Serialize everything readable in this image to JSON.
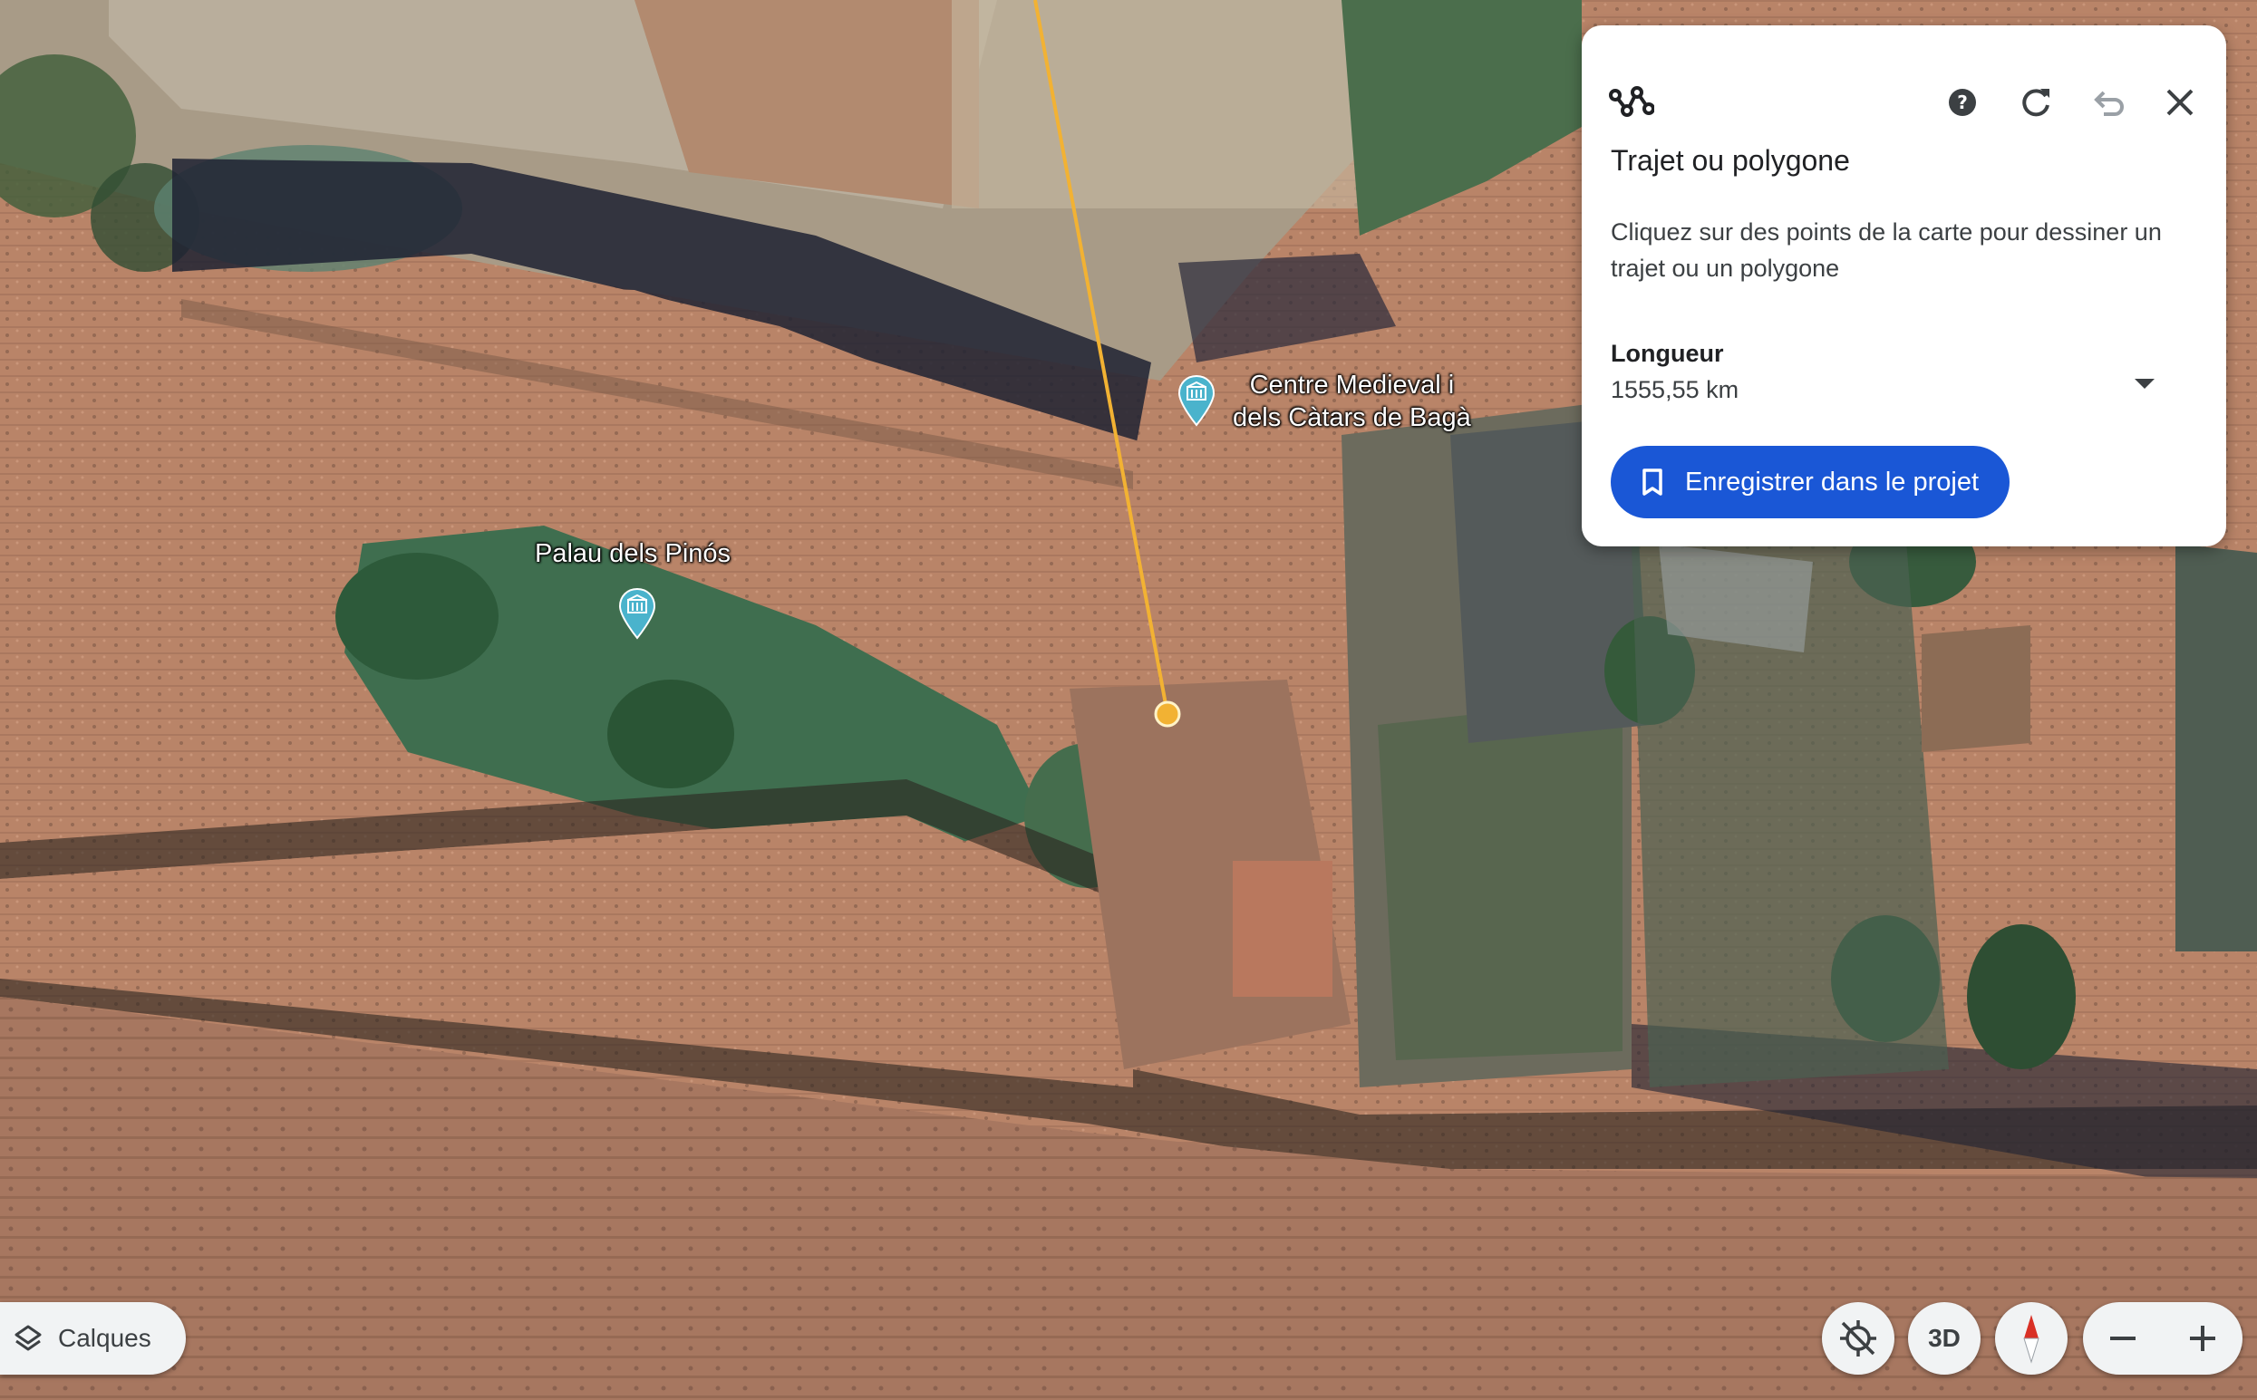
{
  "map": {
    "pois": [
      {
        "name_lines": [
          "Palau dels Pinós"
        ]
      },
      {
        "name_lines": [
          "Centre Medieval i",
          "dels Càtars de Bagà"
        ]
      }
    ],
    "colors": {
      "route_line": "#f2b233",
      "poi_pin": "#4ab3cc",
      "roof": "#b98266",
      "garden": "#3f6e4f"
    }
  },
  "panel": {
    "tool_icon": "path-measure-icon",
    "title": "Trajet ou polygone",
    "description": "Cliquez sur des points de la carte pour dessiner un trajet ou un polygone",
    "length_label": "Longueur",
    "length_value": "1555,55 km",
    "save_label": "Enregistrer dans le projet",
    "accent": "#1a57d6"
  },
  "controls": {
    "layers_label": "Calques",
    "view_3d_label": "3D"
  }
}
